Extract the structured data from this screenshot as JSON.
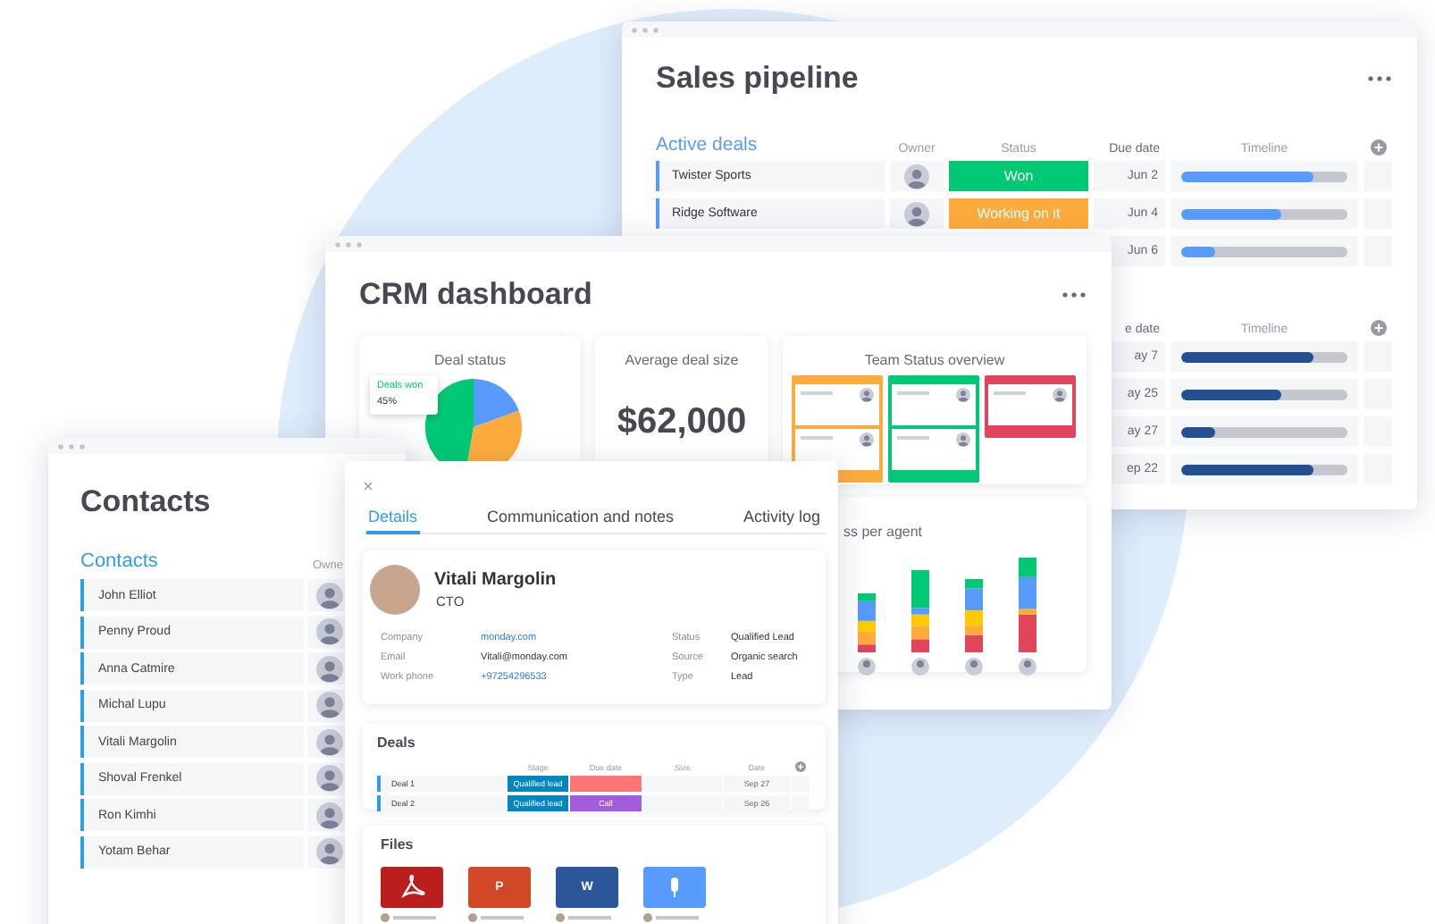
{
  "sales_pipeline": {
    "title": "Sales pipeline",
    "groups": [
      {
        "title": "Active deals",
        "color": "#579bfc",
        "columns": [
          "Owner",
          "Status",
          "Due date",
          "Timeline"
        ],
        "rows": [
          {
            "name": "Twister Sports",
            "avatar": true,
            "status": {
              "label": "Won",
              "color": "#00c875"
            },
            "due": "Jun 2",
            "level": 0.8
          },
          {
            "name": "Ridge Software",
            "avatar": true,
            "status": {
              "label": "Working on it",
              "color": "#fdab3d"
            },
            "due": "Jun 4",
            "level": 0.6
          },
          {
            "due": "Jun 6",
            "level": 0.2
          }
        ]
      },
      {
        "color": "#225091",
        "columns": [
          "e date",
          "Timeline"
        ],
        "rows": [
          {
            "due": "ay 7",
            "level": 0.8
          },
          {
            "due": "ay 25",
            "level": 0.6
          },
          {
            "due": "ay 27",
            "level": 0.2
          },
          {
            "due": "ep 22",
            "level": 0.8
          }
        ]
      }
    ]
  },
  "crm_dashboard": {
    "title": "CRM dashboard",
    "deal_status": {
      "title": "Deal status",
      "tooltip_label": "Deals won",
      "tooltip_value": "45%"
    },
    "average_deal_size": {
      "title": "Average deal size",
      "value": "$62,000"
    },
    "team_status": {
      "title": "Team Status overview",
      "columns": [
        {
          "color": "#fdab3d",
          "cards": [
            {
              "avatar": true
            },
            {
              "avatar": true
            }
          ]
        },
        {
          "color": "#00c875",
          "cards": [
            {
              "avatar": true
            },
            {
              "avatar": true
            }
          ]
        },
        {
          "color": "#e2445c",
          "cards": [
            {
              "avatar": true
            }
          ]
        }
      ]
    },
    "agent_chart": {
      "title": "ss per agent"
    }
  },
  "contacts": {
    "title": "Contacts",
    "group": "Contacts",
    "owner_column": "Owne",
    "rows": [
      {
        "name": "John Elliot"
      },
      {
        "name": "Penny Proud"
      },
      {
        "name": "Anna Catmire"
      },
      {
        "name": "Michal Lupu"
      },
      {
        "name": "Vitali Margolin"
      },
      {
        "name": "Shoval Frenkel"
      },
      {
        "name": "Ron Kimhi"
      },
      {
        "name": "Yotam Behar"
      }
    ]
  },
  "contact_details": {
    "tabs": [
      {
        "label": "Details",
        "selected": true
      },
      {
        "label": "Communication and notes",
        "selected": false
      },
      {
        "label": "Activity log",
        "selected": false
      }
    ],
    "name": "Vitali Margolin",
    "role": "CTO",
    "fields": [
      {
        "label": "Company",
        "value": "monday.com",
        "link": true
      },
      {
        "label": "Email",
        "value": "Vitali@monday.com",
        "link": false
      },
      {
        "label": "Work phone",
        "value": "+97254296533",
        "link": true
      },
      {
        "label": "Status",
        "value": "Qualified Lead",
        "link": false
      },
      {
        "label": "Source",
        "value": "Organic search",
        "link": false
      },
      {
        "label": "Type",
        "value": "Lead",
        "link": false
      }
    ],
    "deals": {
      "title": "Deals",
      "columns": [
        "Stage",
        "Due date",
        "Size",
        "Date"
      ],
      "rows": [
        {
          "name": "Deal 1",
          "stage": "Qualified lead",
          "due": {
            "color": "#ff7575"
          },
          "date": "Sep 27"
        },
        {
          "name": "Deal 2",
          "stage": "Qualified lead",
          "due": {
            "label": "Call",
            "color": "#a25ddc"
          },
          "date": "Sep 26"
        }
      ]
    },
    "files": {
      "title": "Files",
      "items": [
        {
          "kind": "pdf",
          "color": "#bb1e1e"
        },
        {
          "kind": "letter",
          "label": "P",
          "color": "#d24726"
        },
        {
          "kind": "letter",
          "label": "W",
          "color": "#2b579a"
        },
        {
          "kind": "audio",
          "color": "#579bfc"
        }
      ]
    }
  }
}
